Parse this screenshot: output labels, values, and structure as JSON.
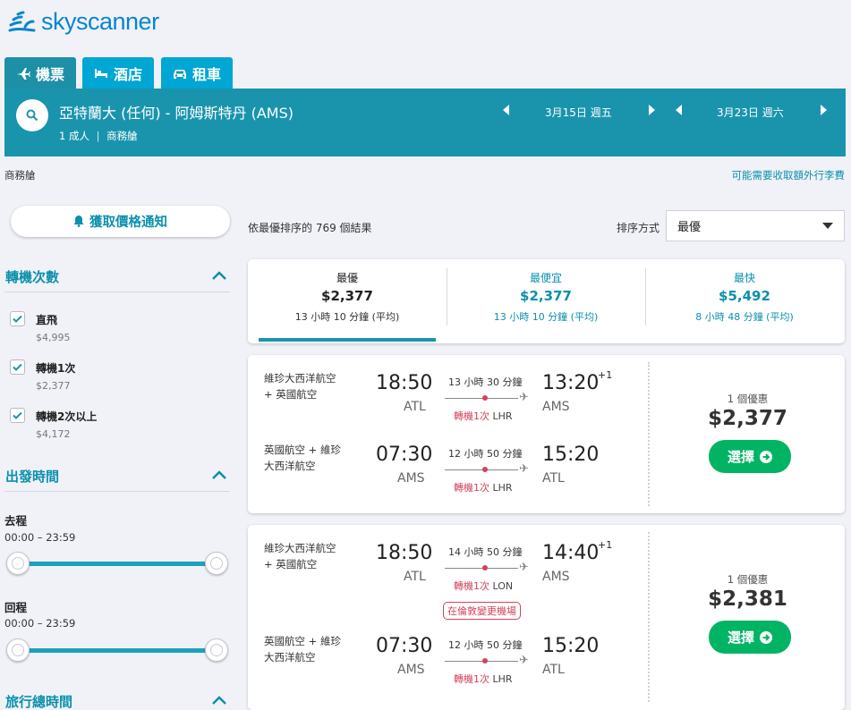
{
  "brand": {
    "name": "skyscanner",
    "color": "#0785d1"
  },
  "tabs": [
    {
      "label": "機票",
      "icon": "airplane-icon",
      "active": true
    },
    {
      "label": "酒店",
      "icon": "bed-icon",
      "active": false
    },
    {
      "label": "租車",
      "icon": "car-icon",
      "active": false
    }
  ],
  "search": {
    "route": "亞特蘭大 (任何) - 阿姆斯特丹 (AMS)",
    "passengers": "1 成人",
    "cabin": "商務艙",
    "depart_date": "3月15日 週五",
    "return_date": "3月23日 週六",
    "accent": "#1a94ad"
  },
  "cabin_label": "商務艙",
  "fees_link": "可能需要收取額外行李費",
  "sidebar": {
    "alert_button": "獲取價格通知",
    "stops": {
      "title": "轉機次數",
      "options": [
        {
          "label": "直飛",
          "price": "$4,995",
          "checked": true
        },
        {
          "label": "轉機1次",
          "price": "$2,377",
          "checked": true
        },
        {
          "label": "轉機2次以上",
          "price": "$4,172",
          "checked": true
        }
      ]
    },
    "departure_times": {
      "title": "出發時間",
      "outbound_label": "去程",
      "outbound_range": "00:00 – 23:59",
      "return_label": "回程",
      "return_range": "00:00 – 23:59"
    },
    "duration": {
      "title": "旅行總時間"
    }
  },
  "results": {
    "count_text": "依最優排序的 769 個結果",
    "sort_label": "排序方式",
    "sort_value": "最優"
  },
  "summary": [
    {
      "title": "最優",
      "price": "$2,377",
      "duration": "13 小時 10 分鐘 (平均)",
      "active": true
    },
    {
      "title": "最便宜",
      "price": "$2,377",
      "duration": "13 小時 10 分鐘 (平均)",
      "active": false
    },
    {
      "title": "最快",
      "price": "$5,492",
      "duration": "8 小時 48 分鐘 (平均)",
      "active": false
    }
  ],
  "cards": [
    {
      "legs": [
        {
          "airline_1": "維珍大西洋航空",
          "airline_2": "+ 英國航空",
          "dep_time": "18:50",
          "dep_code": "ATL",
          "duration": "13 小時 30 分鐘",
          "stops": "轉機1次",
          "via": "LHR",
          "arr_time": "13:20",
          "day_offset": "+1",
          "arr_code": "AMS"
        },
        {
          "airline_1": "英國航空 + 維珍",
          "airline_2": "大西洋航空",
          "dep_time": "07:30",
          "dep_code": "AMS",
          "duration": "12 小時 50 分鐘",
          "stops": "轉機1次",
          "via": "LHR",
          "arr_time": "15:20",
          "day_offset": "",
          "arr_code": "ATL"
        }
      ],
      "deals": "1 個優惠",
      "price": "$2,377",
      "select_label": "選擇"
    },
    {
      "legs": [
        {
          "airline_1": "維珍大西洋航空",
          "airline_2": "+ 英國航空",
          "dep_time": "18:50",
          "dep_code": "ATL",
          "duration": "14 小時 50 分鐘",
          "stops": "轉機1次",
          "via": "LON",
          "arr_time": "14:40",
          "day_offset": "+1",
          "arr_code": "AMS",
          "warning": "在倫敦變更機場"
        },
        {
          "airline_1": "英國航空 + 維珍",
          "airline_2": "大西洋航空",
          "dep_time": "07:30",
          "dep_code": "AMS",
          "duration": "12 小時 50 分鐘",
          "stops": "轉機1次",
          "via": "LHR",
          "arr_time": "15:20",
          "day_offset": "",
          "arr_code": "ATL"
        }
      ],
      "deals": "1 個優惠",
      "price": "$2,381",
      "select_label": "選擇"
    }
  ],
  "colors": {
    "teal": "#0b90ad",
    "green": "#00b464",
    "stop_red": "#d1435b"
  }
}
